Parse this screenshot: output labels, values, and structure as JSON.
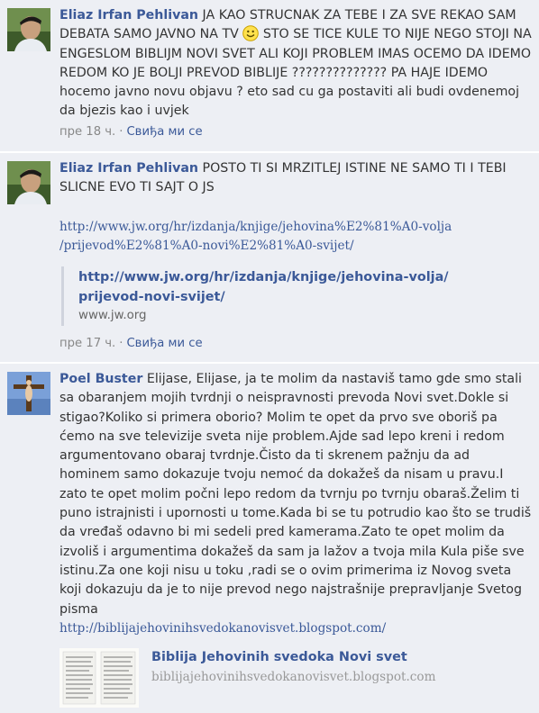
{
  "comments": [
    {
      "author": "Eliaz Irfan Pehlivan",
      "text_a": "JA KAO STRUCNAK ZA TEBE I ZA SVE REKAO SAM DEBATA SAMO JAVNO NA TV",
      "emoticon": "smiley-icon",
      "text_b": "STO SE TICE KULE TO NIJE NEGO STOJI NA ENGESLOM BIBLIJM NOVI SVET ALI KOJI PROBLEM IMAS OCEMO DA IDEMO REDOM KO JE BOLJI PREVOD BIBLIJE ?????????????? PA HAJE IDEMO hocemo javno novu objavu ? eto sad cu ga postaviti ali budi ovdenemoj da bjezis kao i uvjek",
      "time": "пре 18 ч.",
      "separator": "·",
      "like": "Свиђа ми се"
    },
    {
      "author": "Eliaz Irfan Pehlivan",
      "text": "POSTO TI SI MRZITLEJ ISTINE NE SAMO TI I TEBI SLICNE EVO TI SAJT O JS",
      "link_line1": "http://www.jw.org/hr/izdanja/knjige/jehovina%E2%81%A0-volja",
      "link_line2": "/prijevod%E2%81%A0-novi%E2%81%A0-svijet/",
      "share_title_line1": "http://www.jw.org/hr/izdanja/knjige/jehovina-volja/",
      "share_title_line2": "prijevod-novi-svijet/",
      "share_domain": "www.jw.org",
      "time": "пре 17 ч.",
      "separator": "·",
      "like": "Свиђа ми се"
    },
    {
      "author": "Poel Buster",
      "text": "Elijase, Elijase, ja te molim da nastaviš tamo gde smo stali sa obaranjem mojih tvrdnji o neispravnosti prevoda Novi svet.Dokle si stigao?Koliko si primera oborio? Molim te opet da prvo sve oboriš pa ćemo na sve televizije sveta nije problem.Ajde sad lepo kreni i redom argumentovano obaraj tvrdnje.Čisto da ti skrenem pažnju da ad hominem samo dokazuje tvoju nemoć da dokažeš da nisam u pravu.I zato te opet molim počni lepo redom da tvrnju po tvrnju obaraš.Želim ti puno istrajnisti i upornosti u tome.Kada bi se tu potrudio kao što se trudiš da vređaš odavno bi mi sedeli pred kamerama.Zato te opet molim da izvoliš i argumentima dokažeš da sam ja lažov a tvoja mila Kula piše sve istinu.Za one koji nisu u toku ,radi se o ovim primerima iz Novog sveta koji dokazuju da je to nije prevod nego najstrašnije prepravljanje Svetog pisma",
      "link": "http://biblijajehovinihsvedokanovisvet.blogspot.com/",
      "preview_title": "Biblija Jehovinih svedoka Novi svet",
      "preview_domain": "biblijajehovinihsvedokanovisvet.blogspot.com"
    }
  ],
  "colors": {
    "background": "#edeff4",
    "author": "#3b5998",
    "text": "#333333",
    "meta": "#888888"
  }
}
